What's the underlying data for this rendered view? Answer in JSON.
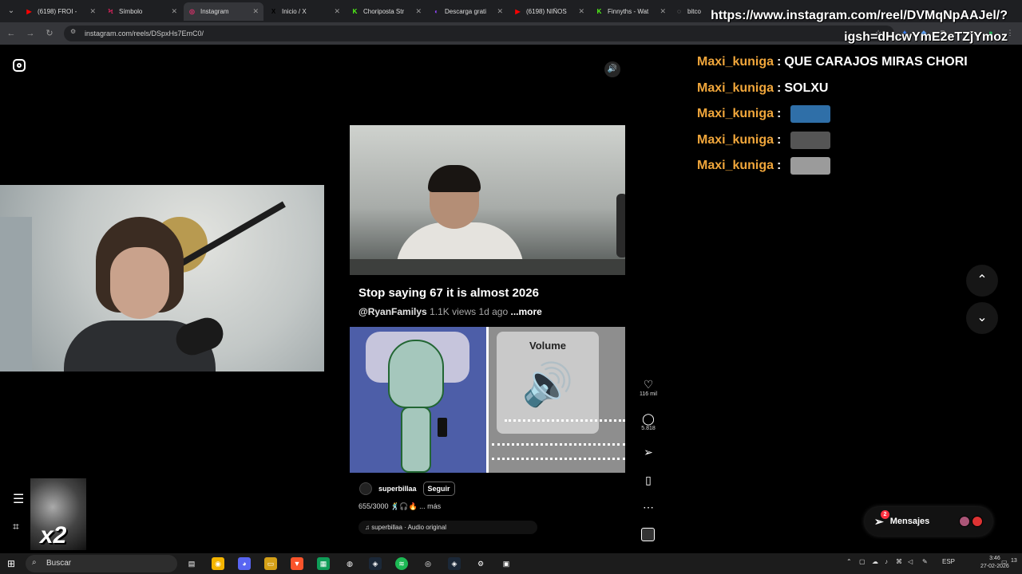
{
  "browser": {
    "tabs": [
      {
        "label": "(6198) FROI - ",
        "fav_color": "#ff0000",
        "fav": "▶"
      },
      {
        "label": "Símbolo",
        "fav_color": "#e0245e",
        "fav": "Ϟ"
      },
      {
        "label": "Instagram",
        "fav_color": "#e1306c",
        "fav": "◎"
      },
      {
        "label": "Inicio / X",
        "fav_color": "#000000",
        "fav": "X"
      },
      {
        "label": "Choriposta Str",
        "fav_color": "#53fc18",
        "fav": "K"
      },
      {
        "label": "Descarga grati",
        "fav_color": "#9146ff",
        "fav": "◐"
      },
      {
        "label": "(6198) NIÑOS",
        "fav_color": "#ff0000",
        "fav": "▶"
      },
      {
        "label": "Finnyths - Wat",
        "fav_color": "#53fc18",
        "fav": "K"
      },
      {
        "label": "bitco",
        "fav_color": "#cccccc",
        "fav": "◌"
      }
    ],
    "address": "instagram.com/reels/DSpxHs7EmC0/"
  },
  "overlay_url": {
    "line1": "https://www.instagram.com/reel/DVMqNpAAJel/?",
    "line2": "igsh=dHcwYmE2eTZjYmoz"
  },
  "reel": {
    "title": "Stop saying 67 it is almost 2026",
    "handle": "@RyanFamilys",
    "views": "1.1K views",
    "age": "1d ago",
    "more": "...more",
    "volume_card_title": "Volume",
    "creator": "superbillaa",
    "follow_label": "Seguir",
    "caption": "655/3000 🕺🎧🔥 ... más",
    "audio": "♫ superbillaa · Audio original"
  },
  "actions": {
    "likes": "116 mil",
    "comments": "5.818"
  },
  "chat": [
    {
      "user": "Maxi_kuniga",
      "msg": "QUE CARAJOS MIRAS CHORI",
      "emote": null
    },
    {
      "user": "Maxi_kuniga",
      "msg": "SOLXU",
      "emote": null
    },
    {
      "user": "Maxi_kuniga",
      "msg": "",
      "emote": "#2f6fa8"
    },
    {
      "user": "Maxi_kuniga",
      "msg": "",
      "emote": "#555555"
    },
    {
      "user": "Maxi_kuniga",
      "msg": "",
      "emote": "#9b9b9b"
    }
  ],
  "messages": {
    "label": "Mensajes",
    "badge": "2"
  },
  "stream_overlay": {
    "multiplier": "x2"
  },
  "taskbar": {
    "search_placeholder": "Buscar",
    "language": "ESP",
    "time": "3:46",
    "date": "27-02-2026",
    "notifications": "13"
  }
}
